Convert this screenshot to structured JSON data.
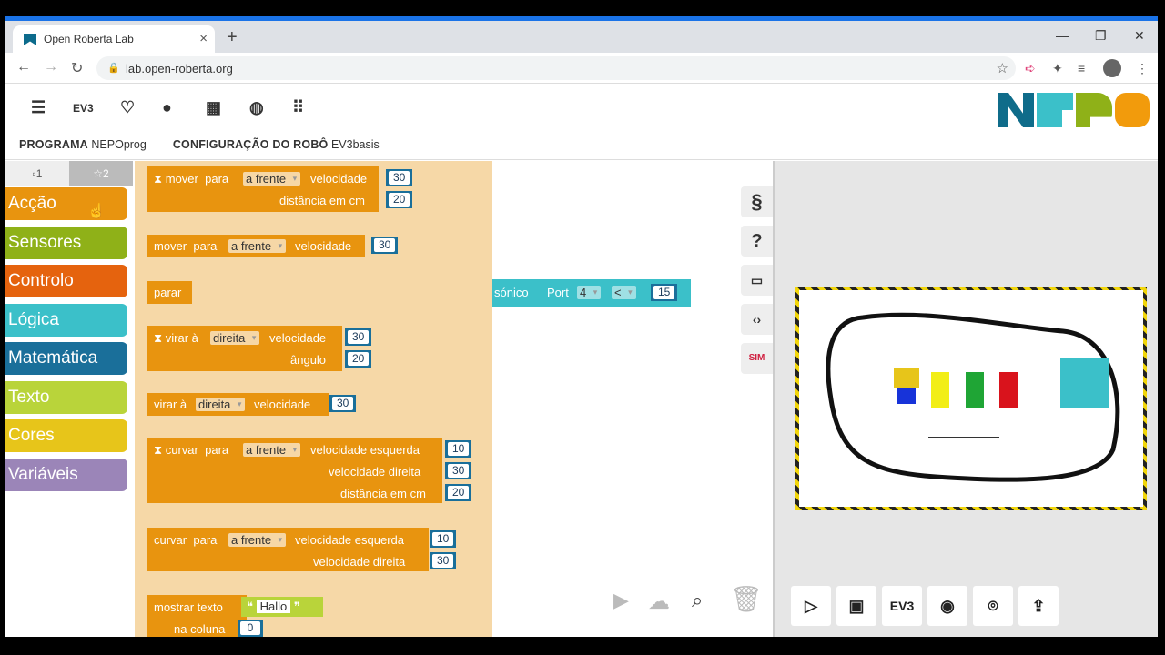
{
  "browser": {
    "tab_title": "Open Roberta Lab",
    "url": "lab.open-roberta.org",
    "new_tab": "+",
    "close": "×"
  },
  "header": {
    "ev3_label": "EV3",
    "program_label": "PROGRAMA",
    "program_name": "NEPOprog",
    "config_label": "CONFIGURAÇÃO DO ROBÔ",
    "config_name": "EV3basis"
  },
  "level_tabs": [
    "1",
    "2"
  ],
  "categories": [
    {
      "label": "Acção",
      "color": "#e8940f"
    },
    {
      "label": "Sensores",
      "color": "#8fb118"
    },
    {
      "label": "Controlo",
      "color": "#e5630e"
    },
    {
      "label": "Lógica",
      "color": "#3bc0c9"
    },
    {
      "label": "Matemática",
      "color": "#1a6f9a"
    },
    {
      "label": "Texto",
      "color": "#b9d43a"
    },
    {
      "label": "Cores",
      "color": "#e7c51a"
    },
    {
      "label": "Variáveis",
      "color": "#9b85b8"
    }
  ],
  "blocks": {
    "b1": {
      "label": "mover",
      "para": "para",
      "dir": "a frente",
      "vel": "velocidade",
      "vel_val": "30",
      "dist": "distância em cm",
      "dist_val": "20"
    },
    "b2": {
      "label": "mover",
      "para": "para",
      "dir": "a frente",
      "vel": "velocidade",
      "vel_val": "30"
    },
    "b3": {
      "label": "parar"
    },
    "b4": {
      "label": "virar à",
      "dir": "direita",
      "vel": "velocidade",
      "vel_val": "30",
      "ang": "ângulo",
      "ang_val": "20"
    },
    "b5": {
      "label": "virar à",
      "dir": "direita",
      "vel": "velocidade",
      "vel_val": "30"
    },
    "b6": {
      "label": "curvar",
      "para": "para",
      "dir": "a frente",
      "vl": "velocidade esquerda",
      "vl_val": "10",
      "vr": "velocidade direita",
      "vr_val": "30",
      "dist": "distância em cm",
      "dist_val": "20"
    },
    "b7": {
      "label": "curvar",
      "para": "para",
      "dir": "a frente",
      "vl": "velocidade esquerda",
      "vl_val": "10",
      "vr": "velocidade direita",
      "vr_val": "30"
    },
    "b8": {
      "label": "mostrar texto",
      "text": "Hallo",
      "col": "na coluna",
      "col_val": "0"
    }
  },
  "sensor_block": {
    "partial": "sónico",
    "port": "Port",
    "port_val": "4",
    "op": "<",
    "val": "15"
  },
  "side_buttons": [
    "§",
    "?",
    "SIM"
  ],
  "sim_buttons": [
    "EV3"
  ]
}
